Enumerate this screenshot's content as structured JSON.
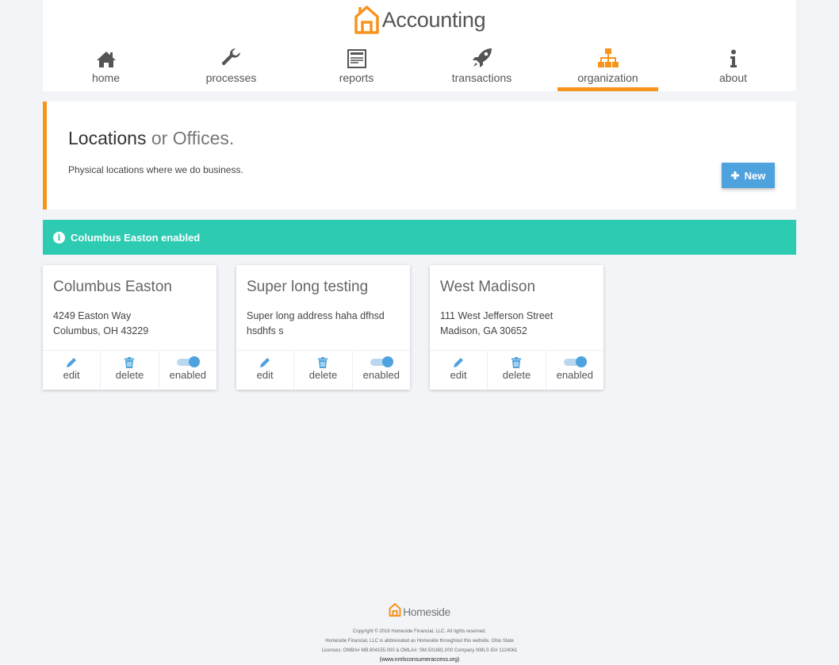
{
  "brand": {
    "name": "Accounting",
    "accent": "#f7941d"
  },
  "nav": {
    "items": [
      {
        "label": "home",
        "icon": "home-icon",
        "active": false
      },
      {
        "label": "processes",
        "icon": "wrench-icon",
        "active": false
      },
      {
        "label": "reports",
        "icon": "newspaper-icon",
        "active": false
      },
      {
        "label": "transactions",
        "icon": "rocket-icon",
        "active": false
      },
      {
        "label": "organization",
        "icon": "sitemap-icon",
        "active": true
      },
      {
        "label": "about",
        "icon": "info-icon",
        "active": false
      }
    ]
  },
  "page": {
    "title_main": "Locations",
    "title_rest": " or Offices.",
    "description": "Physical locations where we do business.",
    "new_button": "New"
  },
  "alert": {
    "message": "Columbus Easton enabled",
    "color": "#2ccbb2"
  },
  "locations": [
    {
      "name": "Columbus Easton",
      "address1": "4249 Easton Way",
      "address2": "Columbus, OH 43229",
      "enabled": true
    },
    {
      "name": "Super long testing",
      "address1": "Super long address haha dfhsd",
      "address2": "hsdhfs s",
      "enabled": true
    },
    {
      "name": "West Madison",
      "address1": "111 West Jefferson Street",
      "address2": "Madison, GA 30652",
      "enabled": true
    }
  ],
  "card_actions": {
    "edit": "edit",
    "delete": "delete",
    "enabled": "enabled"
  },
  "footer": {
    "brand": "Homeside",
    "copyright": "Copyright © 2016 Homeside Financial, LLC. All rights reserved.",
    "abbrev": "Homeside Financial, LLC is abbreviated as Homeside throughout this website. Ohio State",
    "licenses": "Licenses: OMBA# MB.804155.000 & OMLA#: SM.501881.000 Company NMLS ID# 1124061",
    "link": "(www.nmlsconsumeraccess.org)"
  }
}
